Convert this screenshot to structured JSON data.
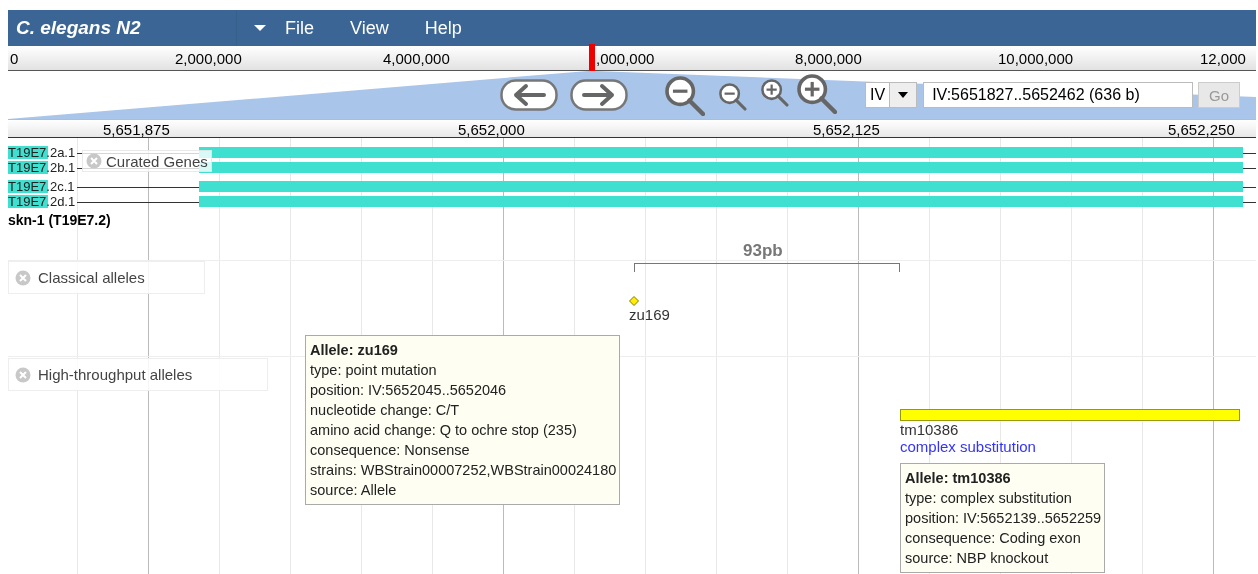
{
  "app": {
    "title": "C. elegans N2",
    "menus": [
      "File",
      "View",
      "Help"
    ]
  },
  "overview": {
    "labels": [
      "0",
      "2,000,000",
      "4,000,000",
      ",000,000",
      "8,000,000",
      "10,000,000",
      "12,000"
    ]
  },
  "navigation": {
    "chromosome": "IV",
    "location": "IV:5651827..5652462 (636 b)",
    "go": {
      "label": "Go",
      "disabled": true
    }
  },
  "ruler": {
    "labels": [
      "5,651,875",
      "5,652,000",
      "5,652,125",
      "5,652,250"
    ]
  },
  "tracks": [
    {
      "kind": "genes",
      "label": "Curated Genes",
      "transcripts": [
        {
          "name": "T19E7.2a.1"
        },
        {
          "name": "T19E7.2b.1"
        },
        {
          "name": "T19E7.2c.1"
        },
        {
          "name": "T19E7.2d.1"
        }
      ],
      "gene": "skn-1 (T19E7.2)"
    },
    {
      "kind": "alleles",
      "label": "Classical alleles",
      "measure": "93pb",
      "features": [
        {
          "kind": "point",
          "name": "zu169"
        }
      ],
      "popup": {
        "title": "Allele: zu169",
        "lines": [
          "type: point mutation",
          "position: IV:5652045..5652046",
          "nucleotide change: C/T",
          "amino acid change: Q to ochre stop (235)",
          "consequence: Nonsense",
          "strains: WBStrain00007252,WBStrain00024180",
          "source: Allele"
        ]
      }
    },
    {
      "kind": "alleles",
      "label": "High-throughput alleles",
      "features": [
        {
          "kind": "span",
          "name": "tm10386",
          "type": "complex substitution"
        }
      ],
      "popup": {
        "title": "Allele: tm10386",
        "lines": [
          "type: complex substitution",
          "position: IV:5652139..5652259",
          "consequence: Coding exon",
          "source: NBP knockout"
        ]
      }
    }
  ]
}
